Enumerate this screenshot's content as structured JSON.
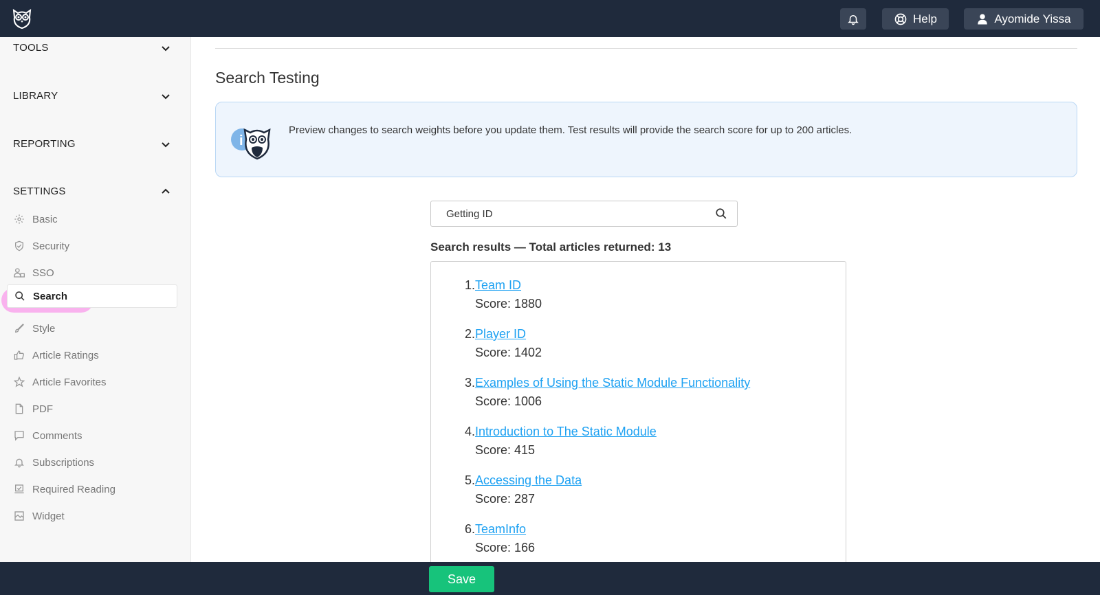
{
  "header": {
    "help_label": "Help",
    "user_name": "Ayomide Yissa"
  },
  "sidebar": {
    "sections": [
      {
        "label": "TOOLS",
        "state": "collapsed"
      },
      {
        "label": "LIBRARY",
        "state": "collapsed"
      },
      {
        "label": "REPORTING",
        "state": "collapsed"
      },
      {
        "label": "SETTINGS",
        "state": "expanded"
      }
    ],
    "settings_items": [
      {
        "label": "Basic",
        "icon": "gear-icon"
      },
      {
        "label": "Security",
        "icon": "shield-icon"
      },
      {
        "label": "SSO",
        "icon": "users-icon"
      },
      {
        "label": "Search",
        "icon": "search-icon",
        "active": true
      },
      {
        "label": "Style",
        "icon": "brush-icon"
      },
      {
        "label": "Article Ratings",
        "icon": "thumbs-up-icon"
      },
      {
        "label": "Article Favorites",
        "icon": "star-icon"
      },
      {
        "label": "PDF",
        "icon": "pdf-file-icon"
      },
      {
        "label": "Comments",
        "icon": "comment-icon"
      },
      {
        "label": "Subscriptions",
        "icon": "bell-icon"
      },
      {
        "label": "Required Reading",
        "icon": "laptop-check-icon"
      },
      {
        "label": "Widget",
        "icon": "widget-icon"
      }
    ]
  },
  "main": {
    "title": "Search Testing",
    "info_text": "Preview changes to search weights before you update them. Test results will provide the search score for up to 200 articles.",
    "search_value": "Getting ID",
    "results_heading": "Search results — Total articles returned: 13",
    "results": [
      {
        "num": "1.",
        "title": "Team ID",
        "score": "Score: 1880"
      },
      {
        "num": "2.",
        "title": "Player ID",
        "score": "Score: 1402"
      },
      {
        "num": "3.",
        "title": "Examples of Using the Static Module Functionality",
        "score": "Score: 1006"
      },
      {
        "num": "4.",
        "title": "Introduction to The Static Module",
        "score": "Score: 415"
      },
      {
        "num": "5.",
        "title": "Accessing the Data",
        "score": "Score: 287"
      },
      {
        "num": "6.",
        "title": "TeamInfo",
        "score": "Score: 166"
      }
    ]
  },
  "footer": {
    "save_label": "Save"
  },
  "colors": {
    "topbar": "#1f2a3c",
    "link": "#1da1f2",
    "save": "#17c37b",
    "highlight": "#f9a6ec",
    "info_bg": "#eef5fd"
  }
}
